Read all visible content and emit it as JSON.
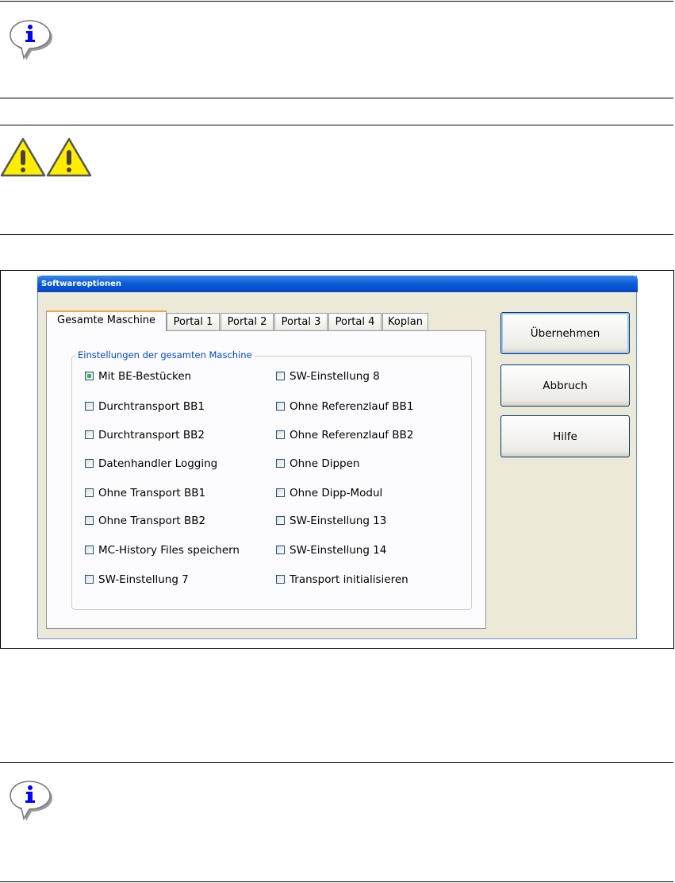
{
  "dialog": {
    "title": "Softwareoptionen",
    "tabs": [
      "Gesamte Maschine",
      "Portal 1",
      "Portal 2",
      "Portal 3",
      "Portal 4",
      "Koplan"
    ],
    "group_label": "Einstellungen der gesamten Maschine",
    "options_left": [
      {
        "label": "Mit BE-Bestücken",
        "checked": true
      },
      {
        "label": "Durchtransport BB1",
        "checked": false
      },
      {
        "label": "Durchtransport BB2",
        "checked": false
      },
      {
        "label": "Datenhandler Logging",
        "checked": false
      },
      {
        "label": "Ohne Transport BB1",
        "checked": false
      },
      {
        "label": "Ohne Transport BB2",
        "checked": false
      },
      {
        "label": "MC-History Files speichern",
        "checked": false
      },
      {
        "label": "SW-Einstellung 7",
        "checked": false
      }
    ],
    "options_right": [
      {
        "label": "SW-Einstellung 8",
        "checked": false
      },
      {
        "label": "Ohne Referenzlauf BB1",
        "checked": false
      },
      {
        "label": "Ohne Referenzlauf BB2",
        "checked": false
      },
      {
        "label": "Ohne Dippen",
        "checked": false
      },
      {
        "label": "Ohne Dipp-Modul",
        "checked": false
      },
      {
        "label": "SW-Einstellung 13",
        "checked": false
      },
      {
        "label": "SW-Einstellung 14",
        "checked": false
      },
      {
        "label": "Transport initialisieren",
        "checked": false
      }
    ],
    "buttons": {
      "apply": "Übernehmen",
      "cancel": "Abbruch",
      "help": "Hilfe"
    }
  },
  "icons": {
    "info": "info-speech-bubble-icon",
    "warning": "warning-triangle-icon"
  }
}
